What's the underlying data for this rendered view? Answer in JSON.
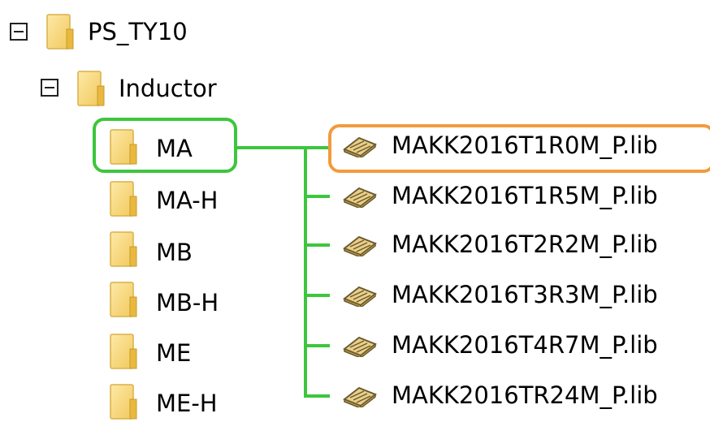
{
  "tree": {
    "root": {
      "label": "PS_TY10",
      "expanded": true,
      "icon": "folder-icon"
    },
    "child": {
      "label": "Inductor",
      "expanded": true,
      "icon": "folder-icon"
    },
    "subfolders": [
      {
        "label": "MA"
      },
      {
        "label": "MA-H"
      },
      {
        "label": "MB"
      },
      {
        "label": "MB-H"
      },
      {
        "label": "ME"
      },
      {
        "label": "ME-H"
      }
    ]
  },
  "files": [
    {
      "label": "MAKK2016T1R0M_P.lib"
    },
    {
      "label": "MAKK2016T1R5M_P.lib"
    },
    {
      "label": "MAKK2016T2R2M_P.lib"
    },
    {
      "label": "MAKK2016T3R3M_P.lib"
    },
    {
      "label": "MAKK2016T4R7M_P.lib"
    },
    {
      "label": "MAKK2016TR24M_P.lib"
    }
  ],
  "colors": {
    "highlight_folder": "#3cc63c",
    "highlight_file": "#f39a3d",
    "folder_fill": "#f7d77c",
    "folder_edge": "#d8b24a"
  }
}
